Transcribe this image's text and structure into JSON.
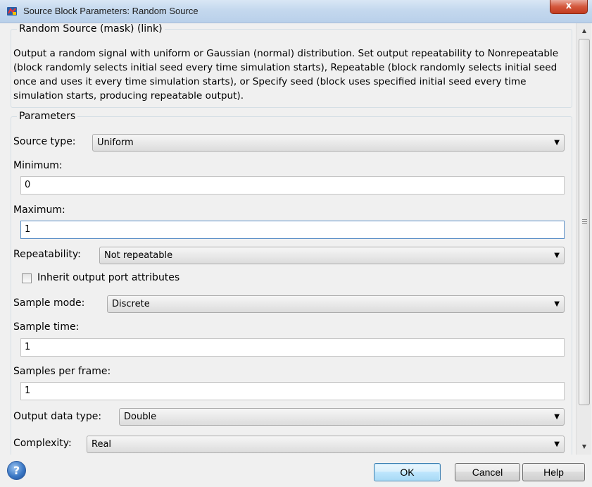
{
  "window": {
    "title": "Source Block Parameters: Random Source",
    "close_label": "x"
  },
  "description_group": {
    "title": "Random Source (mask) (link)",
    "text": "Output a random signal with uniform or Gaussian (normal) distribution.  Set output repeatability to Nonrepeatable (block randomly selects initial seed every time simulation starts), Repeatable (block randomly selects initial seed once and uses it every time simulation starts), or Specify seed (block uses specified initial seed every time simulation starts, producing repeatable output)."
  },
  "parameters": {
    "title": "Parameters",
    "source_type": {
      "label": "Source type:",
      "value": "Uniform"
    },
    "minimum": {
      "label": "Minimum:",
      "value": "0"
    },
    "maximum": {
      "label": "Maximum:",
      "value": "1"
    },
    "repeatability": {
      "label": "Repeatability:",
      "value": "Not repeatable"
    },
    "inherit": {
      "label": "Inherit output port attributes",
      "checked": false
    },
    "sample_mode": {
      "label": "Sample mode:",
      "value": "Discrete"
    },
    "sample_time": {
      "label": "Sample time:",
      "value": "1"
    },
    "samples_per_frame": {
      "label": "Samples per frame:",
      "value": "1"
    },
    "output_data_type": {
      "label": "Output data type:",
      "value": "Double"
    },
    "complexity": {
      "label": "Complexity:",
      "value": "Real"
    }
  },
  "buttons": {
    "help_icon": "?",
    "ok": "OK",
    "cancel": "Cancel",
    "help": "Help"
  },
  "icons": {
    "title_icon": "simulink-block-icon",
    "help_icon": "help-circle-icon",
    "dropdown_arrow": "chevron-down-icon"
  }
}
